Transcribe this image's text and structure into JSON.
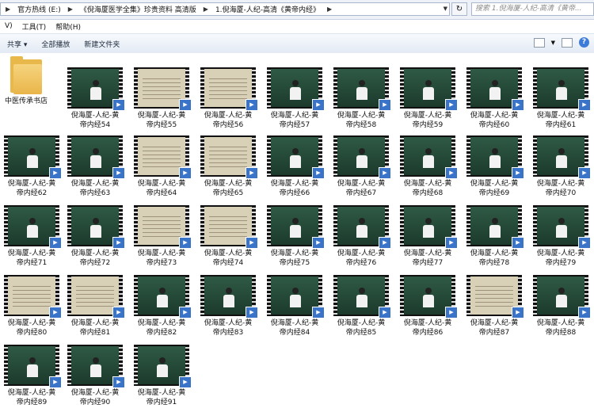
{
  "address_bar": {
    "crumbs": [
      "官方热线 (E:)",
      "《倪海厦医学全集》珍贵资料  高清版",
      "1.倪海厦-人纪-高清《黄帝内经》"
    ],
    "refresh_icon": "refresh-icon"
  },
  "search": {
    "placeholder": "搜索 1.倪海厦-人纪-高清《黄帝..."
  },
  "menu": {
    "items": [
      "V)",
      "工具(T)",
      "帮助(H)"
    ]
  },
  "toolbar": {
    "share": "共享 ▾",
    "play_all": "全部播放",
    "new_folder": "新建文件夹"
  },
  "folder": {
    "name": "中医传承书店",
    "icon": "folder-icon"
  },
  "files": [
    {
      "line1": "倪海厦-人纪-黄",
      "line2": "帝内经54",
      "type": "lecture"
    },
    {
      "line1": "倪海厦-人纪-黄",
      "line2": "帝内经55",
      "type": "slide"
    },
    {
      "line1": "倪海厦-人纪-黄",
      "line2": "帝内经56",
      "type": "slide"
    },
    {
      "line1": "倪海厦-人纪-黄",
      "line2": "帝内经57",
      "type": "lecture"
    },
    {
      "line1": "倪海厦-人纪-黄",
      "line2": "帝内经58",
      "type": "lecture"
    },
    {
      "line1": "倪海厦-人纪-黄",
      "line2": "帝内经59",
      "type": "lecture"
    },
    {
      "line1": "倪海厦-人纪-黄",
      "line2": "帝内经60",
      "type": "lecture"
    },
    {
      "line1": "倪海厦-人纪-黄",
      "line2": "帝内经61",
      "type": "lecture"
    },
    {
      "line1": "倪海厦-人纪-黄",
      "line2": "帝内经62",
      "type": "lecture"
    },
    {
      "line1": "倪海厦-人纪-黄",
      "line2": "帝内经63",
      "type": "lecture"
    },
    {
      "line1": "倪海厦-人纪-黄",
      "line2": "帝内经64",
      "type": "slide"
    },
    {
      "line1": "倪海厦-人纪-黄",
      "line2": "帝内经65",
      "type": "slide"
    },
    {
      "line1": "倪海厦-人纪-黄",
      "line2": "帝内经66",
      "type": "lecture"
    },
    {
      "line1": "倪海厦-人纪-黄",
      "line2": "帝内经67",
      "type": "lecture"
    },
    {
      "line1": "倪海厦-人纪-黄",
      "line2": "帝内经68",
      "type": "lecture"
    },
    {
      "line1": "倪海厦-人纪-黄",
      "line2": "帝内经69",
      "type": "lecture"
    },
    {
      "line1": "倪海厦-人纪-黄",
      "line2": "帝内经70",
      "type": "lecture"
    },
    {
      "line1": "倪海厦-人纪-黄",
      "line2": "帝内经71",
      "type": "lecture"
    },
    {
      "line1": "倪海厦-人纪-黄",
      "line2": "帝内经72",
      "type": "lecture"
    },
    {
      "line1": "倪海厦-人纪-黄",
      "line2": "帝内经73",
      "type": "slide"
    },
    {
      "line1": "倪海厦-人纪-黄",
      "line2": "帝内经74",
      "type": "slide"
    },
    {
      "line1": "倪海厦-人纪-黄",
      "line2": "帝内经75",
      "type": "lecture"
    },
    {
      "line1": "倪海厦-人纪-黄",
      "line2": "帝内经76",
      "type": "lecture"
    },
    {
      "line1": "倪海厦-人纪-黄",
      "line2": "帝内经77",
      "type": "lecture"
    },
    {
      "line1": "倪海厦-人纪-黄",
      "line2": "帝内经78",
      "type": "lecture"
    },
    {
      "line1": "倪海厦-人纪-黄",
      "line2": "帝内经79",
      "type": "lecture"
    },
    {
      "line1": "倪海厦-人纪-黄",
      "line2": "帝内经80",
      "type": "slide"
    },
    {
      "line1": "倪海厦-人纪-黄",
      "line2": "帝内经81",
      "type": "slide"
    },
    {
      "line1": "倪海厦-人纪-黄",
      "line2": "帝内经82",
      "type": "lecture"
    },
    {
      "line1": "倪海厦-人纪-黄",
      "line2": "帝内经83",
      "type": "lecture"
    },
    {
      "line1": "倪海厦-人纪-黄",
      "line2": "帝内经84",
      "type": "lecture"
    },
    {
      "line1": "倪海厦-人纪-黄",
      "line2": "帝内经85",
      "type": "lecture"
    },
    {
      "line1": "倪海厦-人纪-黄",
      "line2": "帝内经86",
      "type": "lecture"
    },
    {
      "line1": "倪海厦-人纪-黄",
      "line2": "帝内经87",
      "type": "slide"
    },
    {
      "line1": "倪海厦-人纪-黄",
      "line2": "帝内经88",
      "type": "lecture"
    },
    {
      "line1": "倪海厦-人纪-黄",
      "line2": "帝内经89",
      "type": "lecture"
    },
    {
      "line1": "倪海厦-人纪-黄",
      "line2": "帝内经90",
      "type": "lecture"
    },
    {
      "line1": "倪海厦-人纪-黄",
      "line2": "帝内经91",
      "type": "lecture"
    }
  ]
}
